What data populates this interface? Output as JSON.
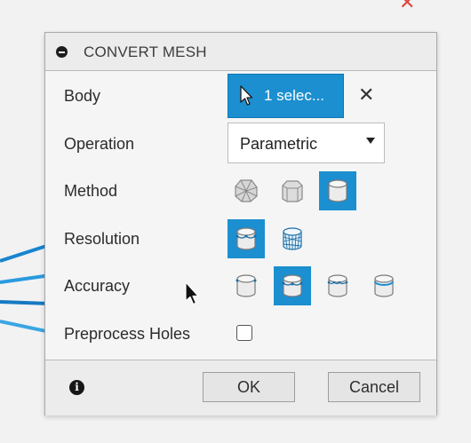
{
  "dialog": {
    "title": "CONVERT MESH",
    "rows": {
      "body": {
        "label": "Body",
        "selection": "1 selec..."
      },
      "operation": {
        "label": "Operation",
        "value": "Parametric"
      },
      "method": {
        "label": "Method",
        "selected_index": 2
      },
      "resolution": {
        "label": "Resolution",
        "selected_index": 0
      },
      "accuracy": {
        "label": "Accuracy",
        "selected_index": 1
      },
      "preprocess_holes": {
        "label": "Preprocess Holes",
        "checked": false
      }
    },
    "buttons": {
      "ok": "OK",
      "cancel": "Cancel"
    }
  },
  "icons": {
    "collapse": "minus-circle-icon",
    "select": "cursor-arrow-icon",
    "clear": "close-icon",
    "info": "info-icon"
  },
  "colors": {
    "accent": "#1b8fd0",
    "panel": "#f5f5f5",
    "titlebar": "#ececec"
  }
}
